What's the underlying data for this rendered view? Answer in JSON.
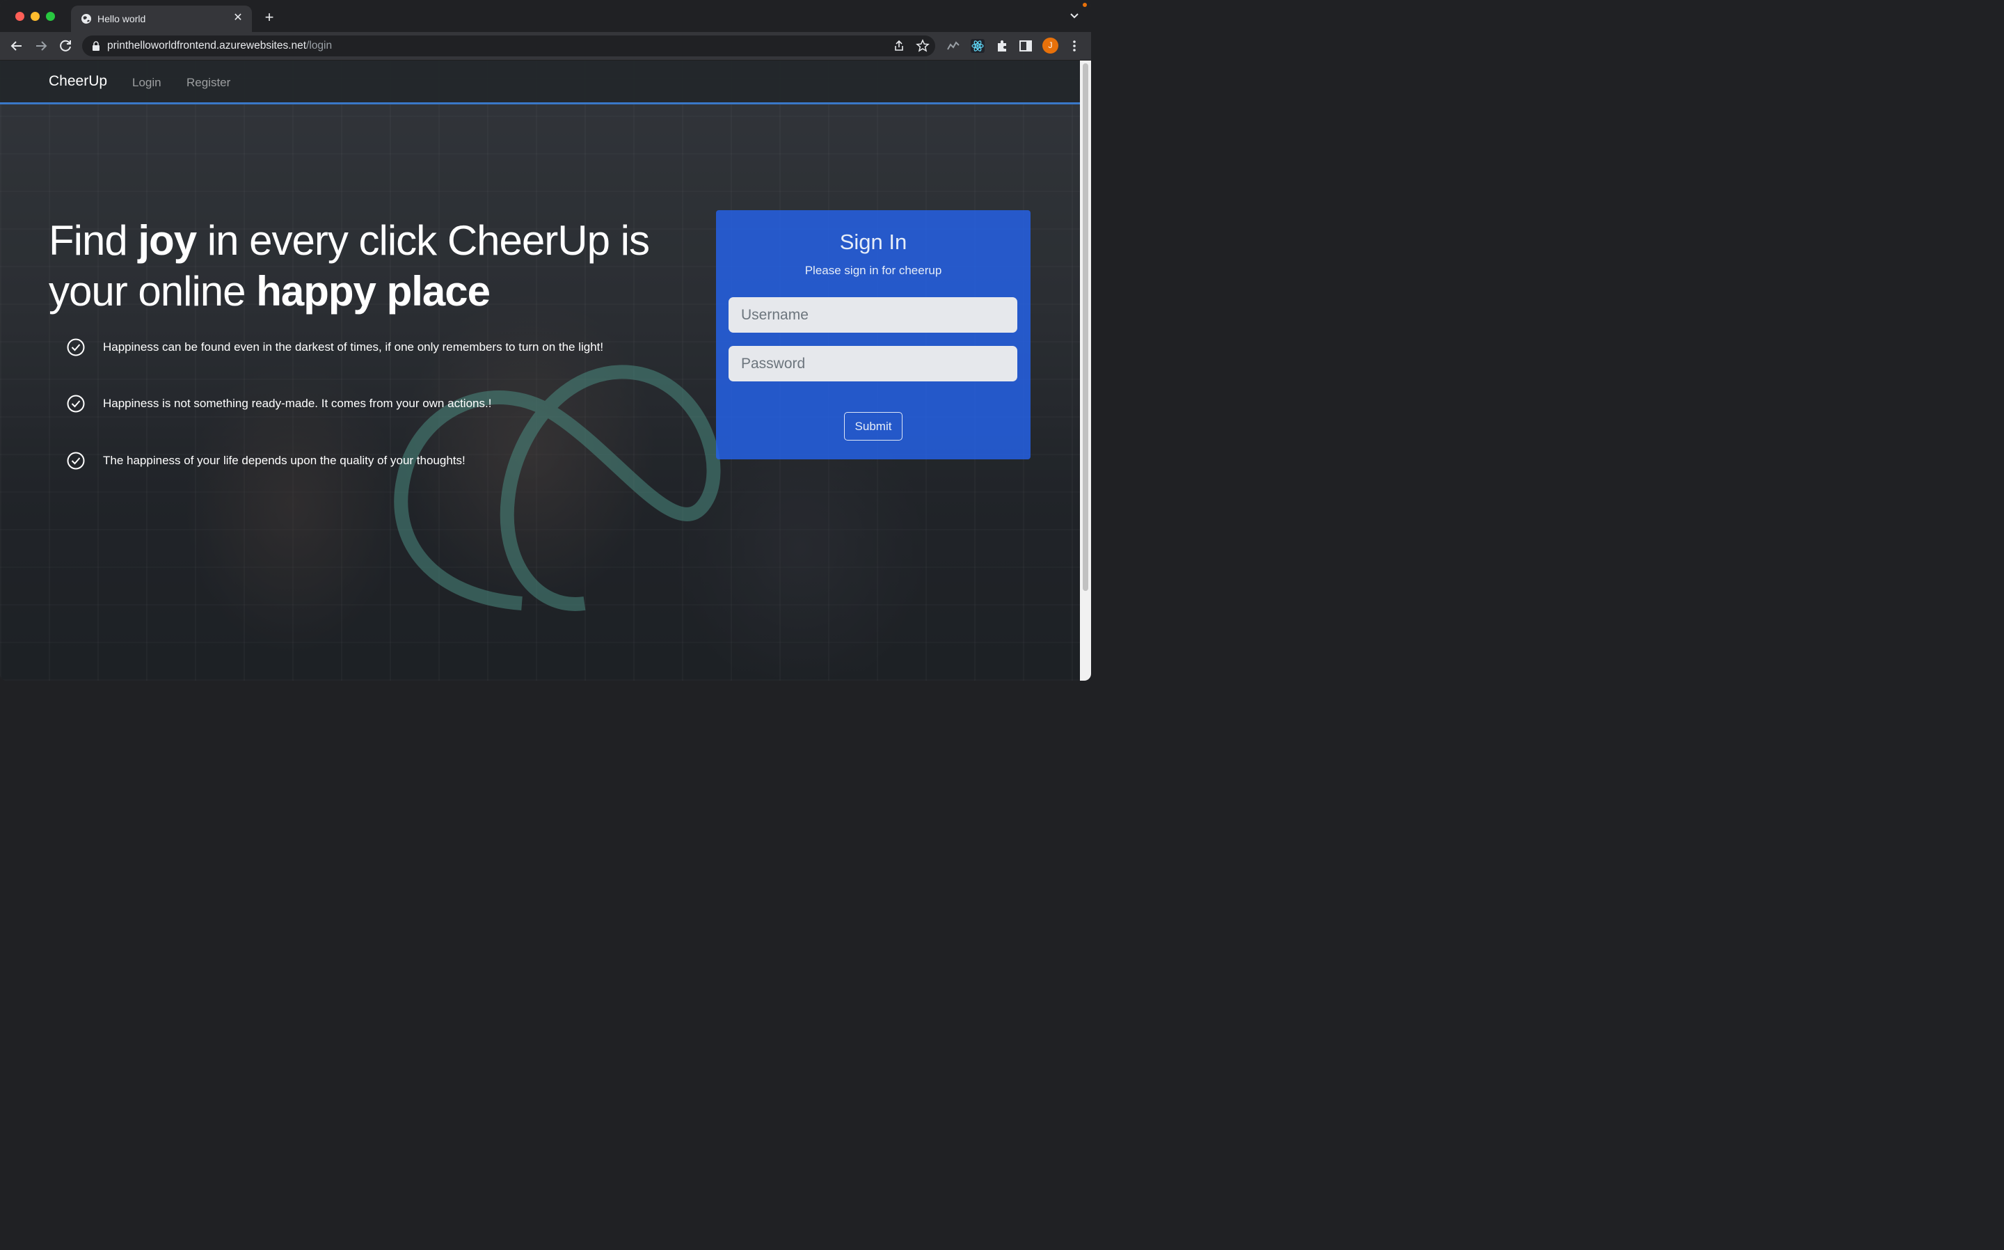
{
  "browser": {
    "tab_title": "Hello world",
    "url_host": "printhelloworldfrontend.azurewebsites.net",
    "url_path": "/login",
    "profile_initial": "J"
  },
  "navbar": {
    "brand": "CheerUp",
    "links": [
      "Login",
      "Register"
    ]
  },
  "hero": {
    "title_parts": [
      "Find ",
      "joy",
      " in every click CheerUp is your online ",
      "happy place"
    ],
    "features": [
      "Happiness can be found even in the darkest of times, if one only remembers to turn on the light!",
      "Happiness is not something ready-made. It comes from your own actions.!",
      "The happiness of your life depends upon the quality of your thoughts!"
    ]
  },
  "signin": {
    "title": "Sign In",
    "subtitle": "Please sign in for cheerup",
    "username_placeholder": "Username",
    "password_placeholder": "Password",
    "submit_label": "Submit"
  },
  "colors": {
    "card": "#2563eb",
    "navbar_border": "#3a78c8",
    "avatar": "#e8710a"
  }
}
